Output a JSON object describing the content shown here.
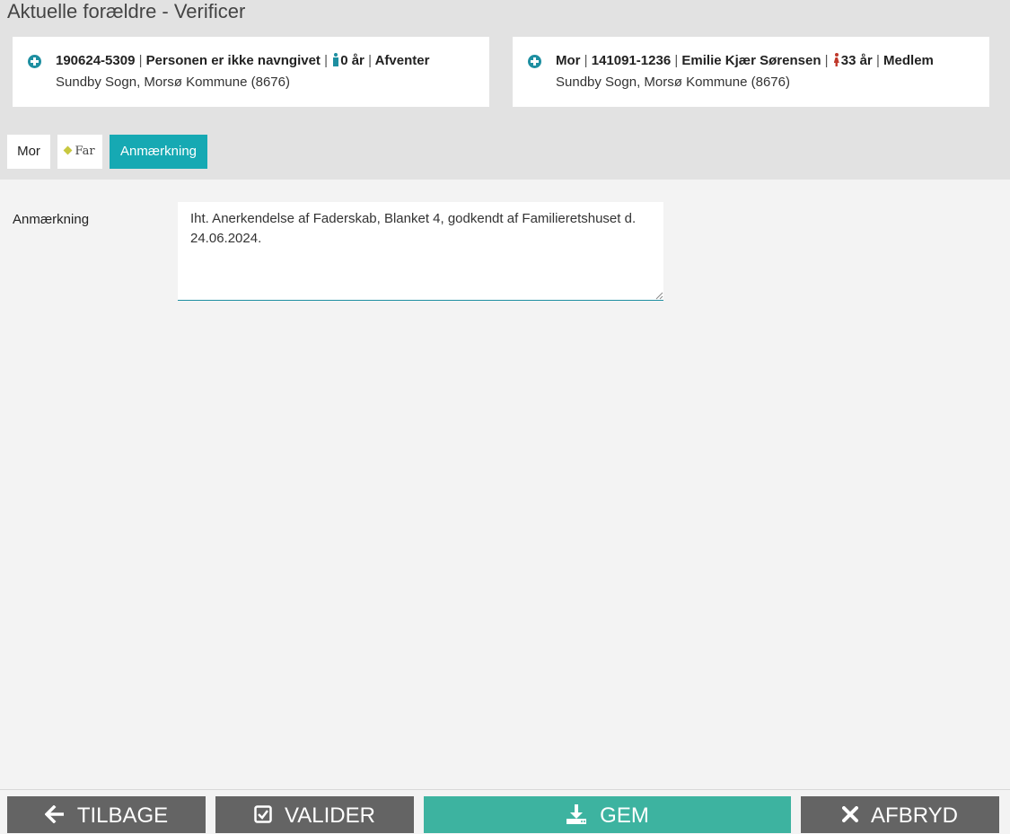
{
  "page_title": "Aktuelle forældre - Verificer",
  "child_card": {
    "cpr": "190624-5309",
    "name": "Personen er ikke navngivet",
    "age": "0 år",
    "status": "Afventer",
    "parish": "Sundby Sogn, Morsø Kommune (8676)"
  },
  "mother_card": {
    "role": "Mor",
    "cpr": "141091-1236",
    "name": "Emilie Kjær Sørensen",
    "age": "33 år",
    "status": "Medlem",
    "parish": "Sundby Sogn, Morsø Kommune (8676)"
  },
  "separator": "|",
  "tabs": {
    "mor": "Mor",
    "far": "Far",
    "anmaerkning": "Anmærkning"
  },
  "form": {
    "label": "Anmærkning",
    "value": "Iht. Anerkendelse af Faderskab, Blanket 4, godkendt af Familieretshuset d. 24.06.2024."
  },
  "buttons": {
    "back": "TILBAGE",
    "validate": "VALIDER",
    "save": "GEM",
    "cancel": "AFBRYD"
  },
  "colors": {
    "accent": "#16a9b3",
    "save_button": "#3db3a0",
    "button_gray": "#646464",
    "male_icon": "#1e8fa1",
    "female_icon": "#c0392b"
  }
}
